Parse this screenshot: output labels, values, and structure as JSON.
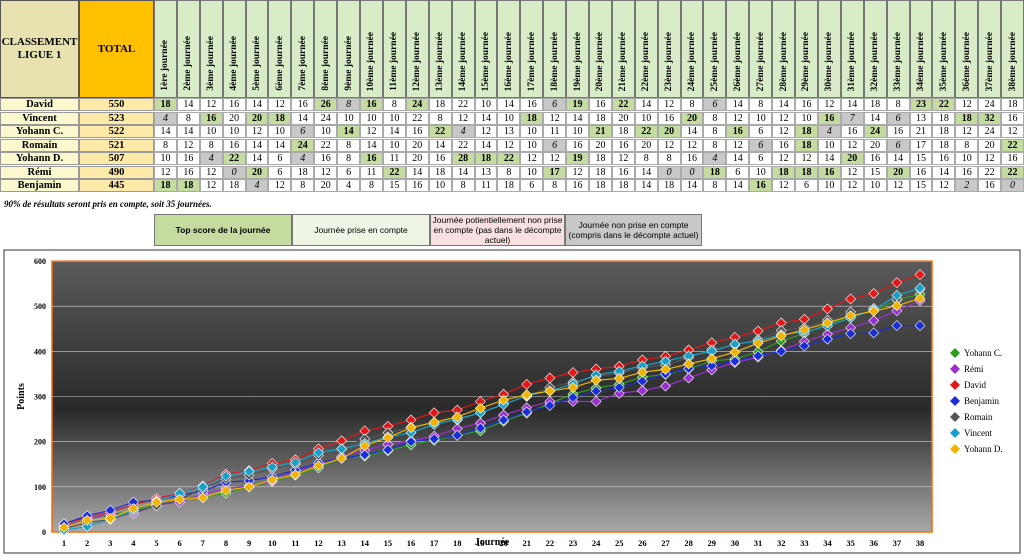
{
  "header": {
    "title": "CLASSEMENT LIGUE 1",
    "total_label": "TOTAL"
  },
  "journees": [
    "1ère journée",
    "2ème journée",
    "3ème journée",
    "4ème journée",
    "5ème journée",
    "6ème journée",
    "7ème journée",
    "8ème journée",
    "9ème journée",
    "10ème journée",
    "11ème journée",
    "12ème journée",
    "13ème journée",
    "14ème journée",
    "15ème journée",
    "16ème journée",
    "17ème journée",
    "18ème journée",
    "19ème journée",
    "20ème journée",
    "21ème journée",
    "22ème journée",
    "23ème journée",
    "24ème journée",
    "25ème journée",
    "26ème journée",
    "27ème journée",
    "28ème journée",
    "29ème journée",
    "30ème journée",
    "31ème journée",
    "32ème journée",
    "33ème journée",
    "34ème journée",
    "35ème journée",
    "36ème journée",
    "37ème journée",
    "38ème journée"
  ],
  "players": [
    {
      "name": "David",
      "total": "550",
      "scores": [
        18,
        14,
        12,
        16,
        14,
        12,
        16,
        26,
        8,
        16,
        8,
        24,
        18,
        22,
        10,
        14,
        16,
        6,
        19,
        16,
        22,
        14,
        12,
        8,
        6,
        14,
        8,
        14,
        16,
        12,
        14,
        18,
        8,
        23,
        22,
        12,
        24,
        18
      ]
    },
    {
      "name": "Vincent",
      "total": "523",
      "scores": [
        4,
        8,
        16,
        20,
        20,
        18,
        14,
        24,
        10,
        10,
        10,
        22,
        8,
        12,
        14,
        10,
        18,
        12,
        14,
        18,
        20,
        10,
        16,
        20,
        8,
        12,
        10,
        12,
        10,
        16,
        7,
        14,
        6,
        13,
        18,
        18,
        32,
        16
      ]
    },
    {
      "name": "Yohann C.",
      "total": "522",
      "scores": [
        14,
        14,
        10,
        10,
        12,
        10,
        6,
        10,
        14,
        12,
        14,
        16,
        22,
        4,
        12,
        13,
        10,
        11,
        10,
        21,
        18,
        22,
        20,
        14,
        8,
        16,
        6,
        12,
        18,
        4,
        16,
        24,
        16,
        21,
        18,
        12,
        24,
        12
      ]
    },
    {
      "name": "Romain",
      "total": "521",
      "scores": [
        8,
        12,
        8,
        16,
        14,
        14,
        24,
        22,
        8,
        14,
        10,
        20,
        14,
        22,
        14,
        12,
        10,
        6,
        16,
        20,
        16,
        20,
        12,
        12,
        8,
        12,
        6,
        16,
        18,
        10,
        12,
        20,
        6,
        17,
        18,
        8,
        20,
        22
      ]
    },
    {
      "name": "Yohann D.",
      "total": "507",
      "scores": [
        10,
        16,
        4,
        22,
        14,
        6,
        4,
        16,
        8,
        16,
        11,
        20,
        16,
        28,
        18,
        22,
        12,
        12,
        19,
        18,
        12,
        8,
        8,
        16,
        4,
        14,
        6,
        12,
        12,
        14,
        20,
        16,
        14,
        15,
        16,
        10,
        12,
        16
      ]
    },
    {
      "name": "Rémi",
      "total": "490",
      "scores": [
        12,
        16,
        12,
        0,
        20,
        6,
        18,
        12,
        6,
        11,
        22,
        14,
        18,
        14,
        13,
        8,
        10,
        17,
        12,
        18,
        16,
        14,
        0,
        0,
        18,
        6,
        10,
        18,
        18,
        16,
        12,
        15,
        20,
        16,
        14,
        16,
        22,
        22
      ]
    },
    {
      "name": "Benjamin",
      "total": "445",
      "scores": [
        18,
        18,
        12,
        18,
        4,
        12,
        8,
        20,
        4,
        8,
        15,
        16,
        10,
        8,
        11,
        18,
        6,
        8,
        16,
        18,
        18,
        14,
        18,
        14,
        8,
        14,
        16,
        12,
        6,
        10,
        12,
        10,
        12,
        15,
        12,
        2,
        16,
        0
      ]
    }
  ],
  "note": "90% de résultats seront pris en compte, soit 35 journées.",
  "legend_boxes": [
    {
      "label": "Top score de la journée",
      "color": "#c4dca0"
    },
    {
      "label": "Journée prise en compte",
      "color": "#eef5e4"
    },
    {
      "label": "Journée potientiellement non prise en compte (pas dans le décompte actuel)",
      "color": "#f8e0e0"
    },
    {
      "label": "Journée non prise en compte (compris dans le décompte actuel)",
      "color": "#c8c8c8"
    }
  ],
  "chart_data": {
    "type": "line",
    "xlabel": "Journée",
    "ylabel": "Points",
    "ylim": [
      0,
      600
    ],
    "yticks": [
      0,
      100,
      200,
      300,
      400,
      500,
      600
    ],
    "x": [
      1,
      2,
      3,
      4,
      5,
      6,
      7,
      8,
      9,
      10,
      11,
      12,
      13,
      14,
      15,
      16,
      17,
      18,
      19,
      20,
      21,
      22,
      23,
      24,
      25,
      26,
      27,
      28,
      29,
      30,
      31,
      32,
      33,
      34,
      35,
      36,
      37,
      38
    ],
    "grid": true,
    "legend_position": "right",
    "series": [
      {
        "name": "Yohann C.",
        "color": "#2e9e1e",
        "values": [
          14,
          28,
          38,
          48,
          60,
          70,
          76,
          86,
          100,
          112,
          126,
          142,
          164,
          168,
          180,
          193,
          203,
          214,
          224,
          245,
          263,
          285,
          305,
          319,
          327,
          343,
          349,
          361,
          379,
          383,
          399,
          423,
          439,
          460,
          478,
          490,
          514,
          526
        ]
      },
      {
        "name": "Rémi",
        "color": "#9b30d0",
        "values": [
          12,
          28,
          40,
          40,
          60,
          66,
          84,
          96,
          102,
          113,
          135,
          149,
          167,
          181,
          194,
          202,
          212,
          229,
          241,
          259,
          275,
          289,
          289,
          289,
          307,
          313,
          323,
          341,
          359,
          375,
          387,
          402,
          422,
          438,
          452,
          468,
          490,
          512
        ]
      },
      {
        "name": "David",
        "color": "#e01818",
        "values": [
          18,
          32,
          44,
          60,
          74,
          86,
          102,
          128,
          136,
          152,
          160,
          184,
          202,
          224,
          234,
          248,
          264,
          270,
          289,
          305,
          327,
          341,
          353,
          361,
          367,
          381,
          389,
          403,
          419,
          431,
          445,
          463,
          471,
          494,
          516,
          528,
          552,
          570
        ]
      },
      {
        "name": "Benjamin",
        "color": "#1a2ed8",
        "values": [
          18,
          36,
          48,
          66,
          70,
          82,
          90,
          110,
          114,
          122,
          137,
          153,
          163,
          171,
          182,
          200,
          206,
          214,
          230,
          248,
          266,
          280,
          298,
          312,
          320,
          334,
          350,
          362,
          368,
          378,
          390,
          400,
          412,
          427,
          439,
          441,
          457,
          457
        ]
      },
      {
        "name": "Romain",
        "color": "#555555",
        "values": [
          8,
          20,
          28,
          44,
          58,
          72,
          96,
          118,
          126,
          140,
          150,
          170,
          184,
          206,
          220,
          232,
          242,
          248,
          264,
          284,
          300,
          320,
          332,
          344,
          352,
          364,
          370,
          386,
          404,
          414,
          426,
          446,
          452,
          469,
          487,
          495,
          515,
          537
        ]
      },
      {
        "name": "Vincent",
        "color": "#1aa0c8",
        "values": [
          4,
          12,
          28,
          48,
          68,
          86,
          100,
          124,
          134,
          144,
          154,
          176,
          184,
          196,
          210,
          220,
          238,
          250,
          264,
          282,
          302,
          312,
          328,
          348,
          356,
          368,
          378,
          390,
          400,
          416,
          423,
          437,
          443,
          456,
          474,
          492,
          524,
          540
        ]
      },
      {
        "name": "Yohann D.",
        "color": "#f0b400",
        "values": [
          10,
          26,
          30,
          52,
          66,
          72,
          76,
          92,
          100,
          116,
          127,
          147,
          163,
          191,
          209,
          231,
          243,
          255,
          274,
          292,
          304,
          312,
          320,
          336,
          340,
          354,
          360,
          372,
          384,
          398,
          418,
          434,
          448,
          463,
          479,
          489,
          501,
          517
        ]
      }
    ]
  }
}
